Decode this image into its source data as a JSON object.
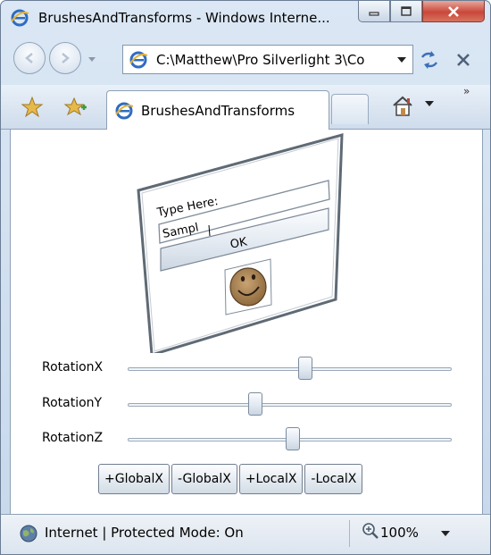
{
  "window": {
    "title": "BrushesAndTransforms - Windows Interne..."
  },
  "address_bar": {
    "url": "C:\\Matthew\\Pro Silverlight 3\\Co"
  },
  "tabs": [
    {
      "label": "BrushesAndTransforms",
      "active": true
    }
  ],
  "panel": {
    "prompt_label": "Type Here:",
    "text_value": "Sampl",
    "ok_label": "OK",
    "image_icon": "smiley-face-icon"
  },
  "sliders": [
    {
      "label": "RotationX",
      "value": 0.55
    },
    {
      "label": "RotationY",
      "value": 0.39
    },
    {
      "label": "RotationZ",
      "value": 0.51
    }
  ],
  "buttons": {
    "global_plus": "+GlobalX",
    "global_minus": "-GlobalX",
    "local_plus": "+LocalX",
    "local_minus": "-LocalX"
  },
  "status_bar": {
    "zone": "Internet | Protected Mode: On",
    "zoom": "100%"
  },
  "colors": {
    "panel_border": "#5f6a75",
    "smiley_fill": "#b08a5a",
    "close_button": "#c9473a"
  }
}
